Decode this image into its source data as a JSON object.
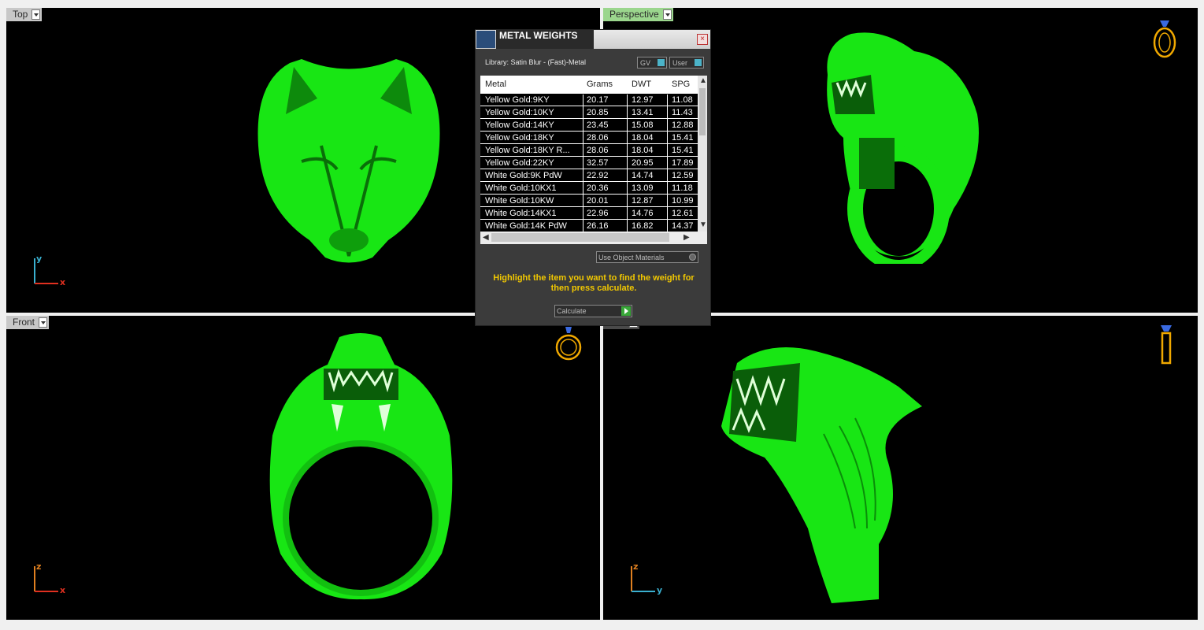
{
  "viewports": {
    "top": {
      "label": "Top",
      "axis_h": "x",
      "axis_v": "y"
    },
    "perspective": {
      "label": "Perspective"
    },
    "front": {
      "label": "Front",
      "axis_h": "x",
      "axis_v": "z"
    },
    "right": {
      "axis_h": "y",
      "axis_v": "z"
    }
  },
  "colors": {
    "model": "#18e614",
    "viewport_bg": "#000000",
    "active_tab": "#9bd68d",
    "accent_text": "#f2c800",
    "axis_x": "#e03020",
    "axis_y": "#3ab0d0",
    "axis_z": "#e08020"
  },
  "dialog": {
    "title": "METAL WEIGHTS",
    "library": "Library: Satin Blur - (Fast)-Metal",
    "gv_label": "GV",
    "user_label": "User",
    "columns": [
      "Metal",
      "Grams",
      "DWT",
      "SPG"
    ],
    "rows": [
      [
        "Yellow Gold:9KY",
        "20.17",
        "12.97",
        "11.08"
      ],
      [
        "Yellow Gold:10KY",
        "20.85",
        "13.41",
        "11.43"
      ],
      [
        "Yellow Gold:14KY",
        "23.45",
        "15.08",
        "12.88"
      ],
      [
        "Yellow Gold:18KY",
        "28.06",
        "18.04",
        "15.41"
      ],
      [
        "Yellow Gold:18KY R...",
        "28.06",
        "18.04",
        "15.41"
      ],
      [
        "Yellow Gold:22KY",
        "32.57",
        "20.95",
        "17.89"
      ],
      [
        "White Gold:9K PdW",
        "22.92",
        "14.74",
        "12.59"
      ],
      [
        "White Gold:10KX1",
        "20.36",
        "13.09",
        "11.18"
      ],
      [
        "White Gold:10KW",
        "20.01",
        "12.87",
        "10.99"
      ],
      [
        "White Gold:14KX1",
        "22.96",
        "14.76",
        "12.61"
      ],
      [
        "White Gold:14K PdW",
        "26.16",
        "16.82",
        "14.37"
      ]
    ],
    "use_object_materials": "Use Object Materials",
    "message": "Highlight the item you want to find the weight for then press calculate.",
    "calculate_label": "Calculate"
  }
}
